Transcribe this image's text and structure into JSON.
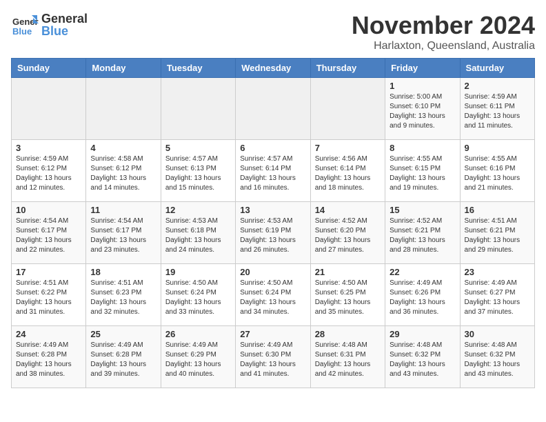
{
  "header": {
    "logo": {
      "general": "General",
      "blue": "Blue"
    },
    "month": "November 2024",
    "location": "Harlaxton, Queensland, Australia"
  },
  "days_of_week": [
    "Sunday",
    "Monday",
    "Tuesday",
    "Wednesday",
    "Thursday",
    "Friday",
    "Saturday"
  ],
  "weeks": [
    [
      {
        "day": "",
        "info": ""
      },
      {
        "day": "",
        "info": ""
      },
      {
        "day": "",
        "info": ""
      },
      {
        "day": "",
        "info": ""
      },
      {
        "day": "",
        "info": ""
      },
      {
        "day": "1",
        "info": "Sunrise: 5:00 AM\nSunset: 6:10 PM\nDaylight: 13 hours and 9 minutes."
      },
      {
        "day": "2",
        "info": "Sunrise: 4:59 AM\nSunset: 6:11 PM\nDaylight: 13 hours and 11 minutes."
      }
    ],
    [
      {
        "day": "3",
        "info": "Sunrise: 4:59 AM\nSunset: 6:12 PM\nDaylight: 13 hours and 12 minutes."
      },
      {
        "day": "4",
        "info": "Sunrise: 4:58 AM\nSunset: 6:12 PM\nDaylight: 13 hours and 14 minutes."
      },
      {
        "day": "5",
        "info": "Sunrise: 4:57 AM\nSunset: 6:13 PM\nDaylight: 13 hours and 15 minutes."
      },
      {
        "day": "6",
        "info": "Sunrise: 4:57 AM\nSunset: 6:14 PM\nDaylight: 13 hours and 16 minutes."
      },
      {
        "day": "7",
        "info": "Sunrise: 4:56 AM\nSunset: 6:14 PM\nDaylight: 13 hours and 18 minutes."
      },
      {
        "day": "8",
        "info": "Sunrise: 4:55 AM\nSunset: 6:15 PM\nDaylight: 13 hours and 19 minutes."
      },
      {
        "day": "9",
        "info": "Sunrise: 4:55 AM\nSunset: 6:16 PM\nDaylight: 13 hours and 21 minutes."
      }
    ],
    [
      {
        "day": "10",
        "info": "Sunrise: 4:54 AM\nSunset: 6:17 PM\nDaylight: 13 hours and 22 minutes."
      },
      {
        "day": "11",
        "info": "Sunrise: 4:54 AM\nSunset: 6:17 PM\nDaylight: 13 hours and 23 minutes."
      },
      {
        "day": "12",
        "info": "Sunrise: 4:53 AM\nSunset: 6:18 PM\nDaylight: 13 hours and 24 minutes."
      },
      {
        "day": "13",
        "info": "Sunrise: 4:53 AM\nSunset: 6:19 PM\nDaylight: 13 hours and 26 minutes."
      },
      {
        "day": "14",
        "info": "Sunrise: 4:52 AM\nSunset: 6:20 PM\nDaylight: 13 hours and 27 minutes."
      },
      {
        "day": "15",
        "info": "Sunrise: 4:52 AM\nSunset: 6:21 PM\nDaylight: 13 hours and 28 minutes."
      },
      {
        "day": "16",
        "info": "Sunrise: 4:51 AM\nSunset: 6:21 PM\nDaylight: 13 hours and 29 minutes."
      }
    ],
    [
      {
        "day": "17",
        "info": "Sunrise: 4:51 AM\nSunset: 6:22 PM\nDaylight: 13 hours and 31 minutes."
      },
      {
        "day": "18",
        "info": "Sunrise: 4:51 AM\nSunset: 6:23 PM\nDaylight: 13 hours and 32 minutes."
      },
      {
        "day": "19",
        "info": "Sunrise: 4:50 AM\nSunset: 6:24 PM\nDaylight: 13 hours and 33 minutes."
      },
      {
        "day": "20",
        "info": "Sunrise: 4:50 AM\nSunset: 6:24 PM\nDaylight: 13 hours and 34 minutes."
      },
      {
        "day": "21",
        "info": "Sunrise: 4:50 AM\nSunset: 6:25 PM\nDaylight: 13 hours and 35 minutes."
      },
      {
        "day": "22",
        "info": "Sunrise: 4:49 AM\nSunset: 6:26 PM\nDaylight: 13 hours and 36 minutes."
      },
      {
        "day": "23",
        "info": "Sunrise: 4:49 AM\nSunset: 6:27 PM\nDaylight: 13 hours and 37 minutes."
      }
    ],
    [
      {
        "day": "24",
        "info": "Sunrise: 4:49 AM\nSunset: 6:28 PM\nDaylight: 13 hours and 38 minutes."
      },
      {
        "day": "25",
        "info": "Sunrise: 4:49 AM\nSunset: 6:28 PM\nDaylight: 13 hours and 39 minutes."
      },
      {
        "day": "26",
        "info": "Sunrise: 4:49 AM\nSunset: 6:29 PM\nDaylight: 13 hours and 40 minutes."
      },
      {
        "day": "27",
        "info": "Sunrise: 4:49 AM\nSunset: 6:30 PM\nDaylight: 13 hours and 41 minutes."
      },
      {
        "day": "28",
        "info": "Sunrise: 4:48 AM\nSunset: 6:31 PM\nDaylight: 13 hours and 42 minutes."
      },
      {
        "day": "29",
        "info": "Sunrise: 4:48 AM\nSunset: 6:32 PM\nDaylight: 13 hours and 43 minutes."
      },
      {
        "day": "30",
        "info": "Sunrise: 4:48 AM\nSunset: 6:32 PM\nDaylight: 13 hours and 43 minutes."
      }
    ]
  ]
}
